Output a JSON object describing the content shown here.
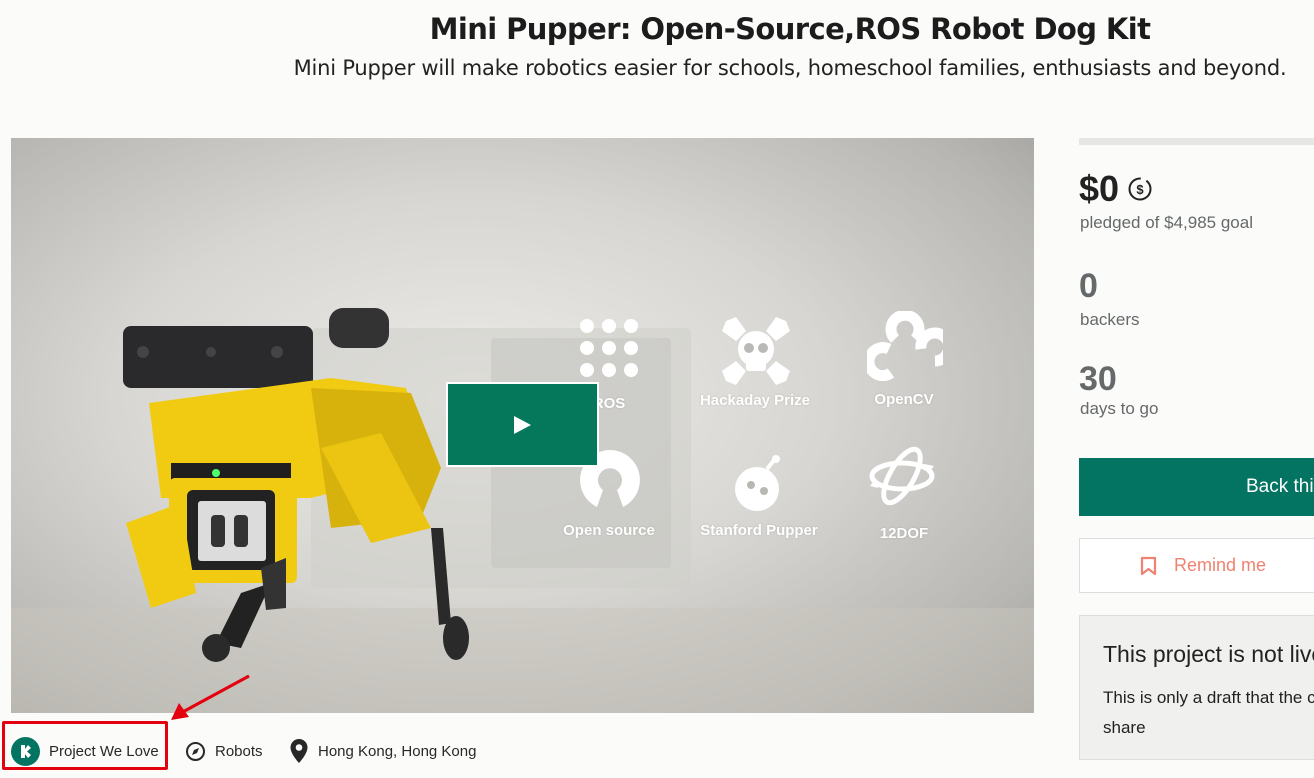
{
  "header": {
    "title": "Mini Pupper: Open-Source,ROS Robot Dog Kit",
    "subtitle": "Mini Pupper will make robotics easier for schools, homeschool families, enthusiasts and beyond."
  },
  "video": {
    "features": [
      {
        "label": "ROS",
        "icon": "ros-dots-icon"
      },
      {
        "label": "Hackaday Prize",
        "icon": "hackaday-skull-icon"
      },
      {
        "label": "OpenCV",
        "icon": "opencv-icon"
      },
      {
        "label": "Open source",
        "icon": "open-source-icon"
      },
      {
        "label": "Stanford Pupper",
        "icon": "stanford-pupper-icon"
      },
      {
        "label": "12DOF",
        "icon": "rotation-arrows-icon"
      }
    ],
    "play_button": "play-icon"
  },
  "tags": [
    {
      "label": "Project We Love",
      "icon": "kickstarter-logo-icon"
    },
    {
      "label": "Robots",
      "icon": "compass-icon"
    },
    {
      "label": "Hong Kong, Hong Kong",
      "icon": "location-pin-icon"
    }
  ],
  "stats": {
    "pledged_amount": "$0",
    "pledged_label": "pledged of $4,985 goal",
    "backers_count": "0",
    "backers_label": "backers",
    "days_count": "30",
    "days_label": "days to go"
  },
  "actions": {
    "back_label": "Back this project",
    "remind_label": "Remind me"
  },
  "notice": {
    "heading": "This project is not live",
    "body": "This is only a draft that the creator can share"
  },
  "colors": {
    "accent": "#037362",
    "remind": "#ef8271",
    "highlight": "#e3000f"
  }
}
